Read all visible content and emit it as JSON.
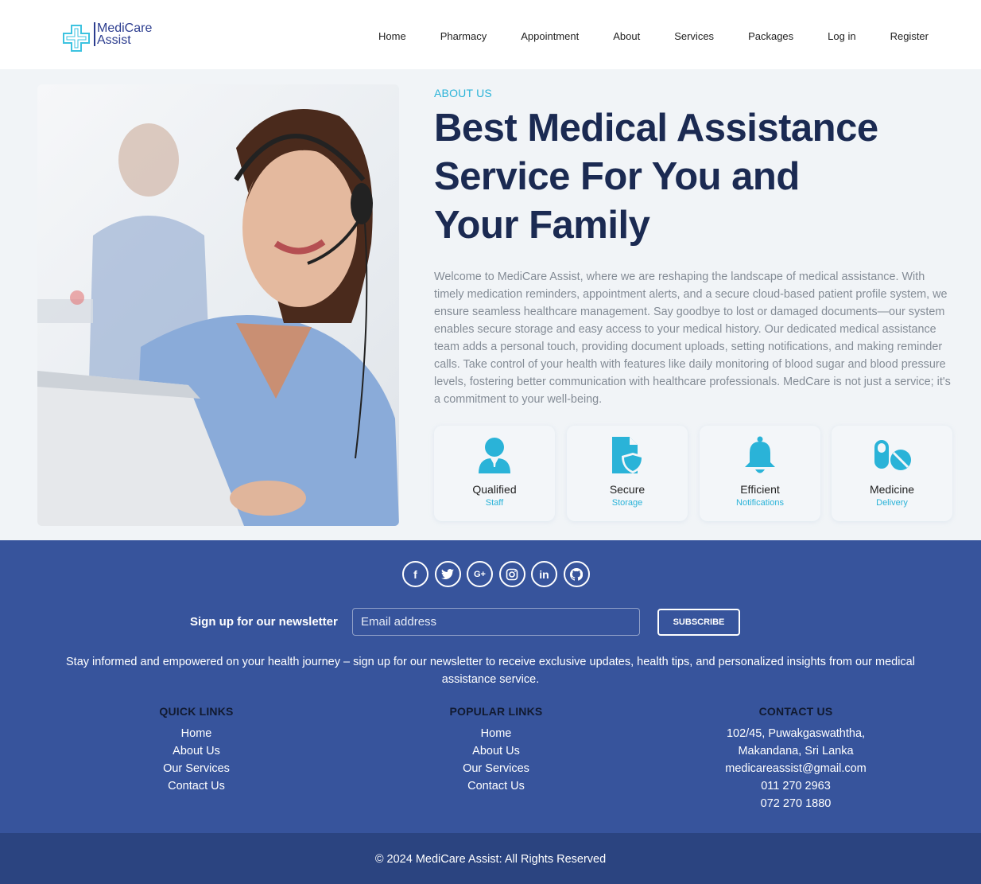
{
  "brand": {
    "name_line1": "MediCare",
    "name_line2": "Assist",
    "accent": "#2ab3d8",
    "navy": "#1b2a52"
  },
  "nav": {
    "items": [
      {
        "label": "Home"
      },
      {
        "label": "Pharmacy"
      },
      {
        "label": "Appointment"
      },
      {
        "label": "About"
      },
      {
        "label": "Services"
      },
      {
        "label": "Packages"
      },
      {
        "label": "Log in"
      },
      {
        "label": "Register"
      }
    ]
  },
  "about": {
    "label": "ABOUT US",
    "title": "Best Medical Assistance Service For You and Your Family",
    "description": "Welcome to MediCare Assist, where we are reshaping the landscape of medical assistance. With timely medication reminders, appointment alerts, and a secure cloud-based patient profile system, we ensure seamless healthcare management. Say goodbye to lost or damaged documents—our system enables secure storage and easy access to your medical history. Our dedicated medical assistance team adds a personal touch, providing document uploads, setting notifications, and making reminder calls. Take control of your health with features like daily monitoring of blood sugar and blood pressure levels, fostering better communication with healthcare professionals. MedCare is not just a service; it's a commitment to your well-being."
  },
  "features": [
    {
      "title": "Qualified",
      "subtitle": "Staff",
      "icon": "doctor-icon"
    },
    {
      "title": "Secure",
      "subtitle": "Storage",
      "icon": "secure-document-icon"
    },
    {
      "title": "Efficient",
      "subtitle": "Notifications",
      "icon": "bell-icon"
    },
    {
      "title": "Medicine",
      "subtitle": "Delivery",
      "icon": "pills-icon"
    }
  ],
  "footer": {
    "socials": [
      {
        "name": "facebook-icon",
        "glyph": "f"
      },
      {
        "name": "twitter-icon",
        "glyph": ""
      },
      {
        "name": "google-plus-icon",
        "glyph": "G+"
      },
      {
        "name": "instagram-icon",
        "glyph": ""
      },
      {
        "name": "linkedin-icon",
        "glyph": "in"
      },
      {
        "name": "github-icon",
        "glyph": ""
      }
    ],
    "newsletter_label": "Sign up for our newsletter",
    "email_placeholder": "Email address",
    "subscribe_label": "SUBSCRIBE",
    "newsletter_desc": "Stay informed and empowered on your health journey – sign up for our newsletter to receive exclusive updates, health tips, and personalized insights from our medical assistance service.",
    "quick_links": {
      "heading": "QUICK LINKS",
      "items": [
        "Home",
        "About Us",
        "Our Services",
        "Contact Us"
      ]
    },
    "popular_links": {
      "heading": "POPULAR LINKS",
      "items": [
        "Home",
        "About Us",
        "Our Services",
        "Contact Us"
      ]
    },
    "contact": {
      "heading": "CONTACT US",
      "lines": [
        "102/45, Puwakgaswaththa,",
        "Makandana, Sri Lanka",
        "medicareassist@gmail.com",
        "011 270 2963",
        "072 270 1880"
      ]
    },
    "copyright": "© 2024 MediCare Assist: All Rights Reserved"
  }
}
